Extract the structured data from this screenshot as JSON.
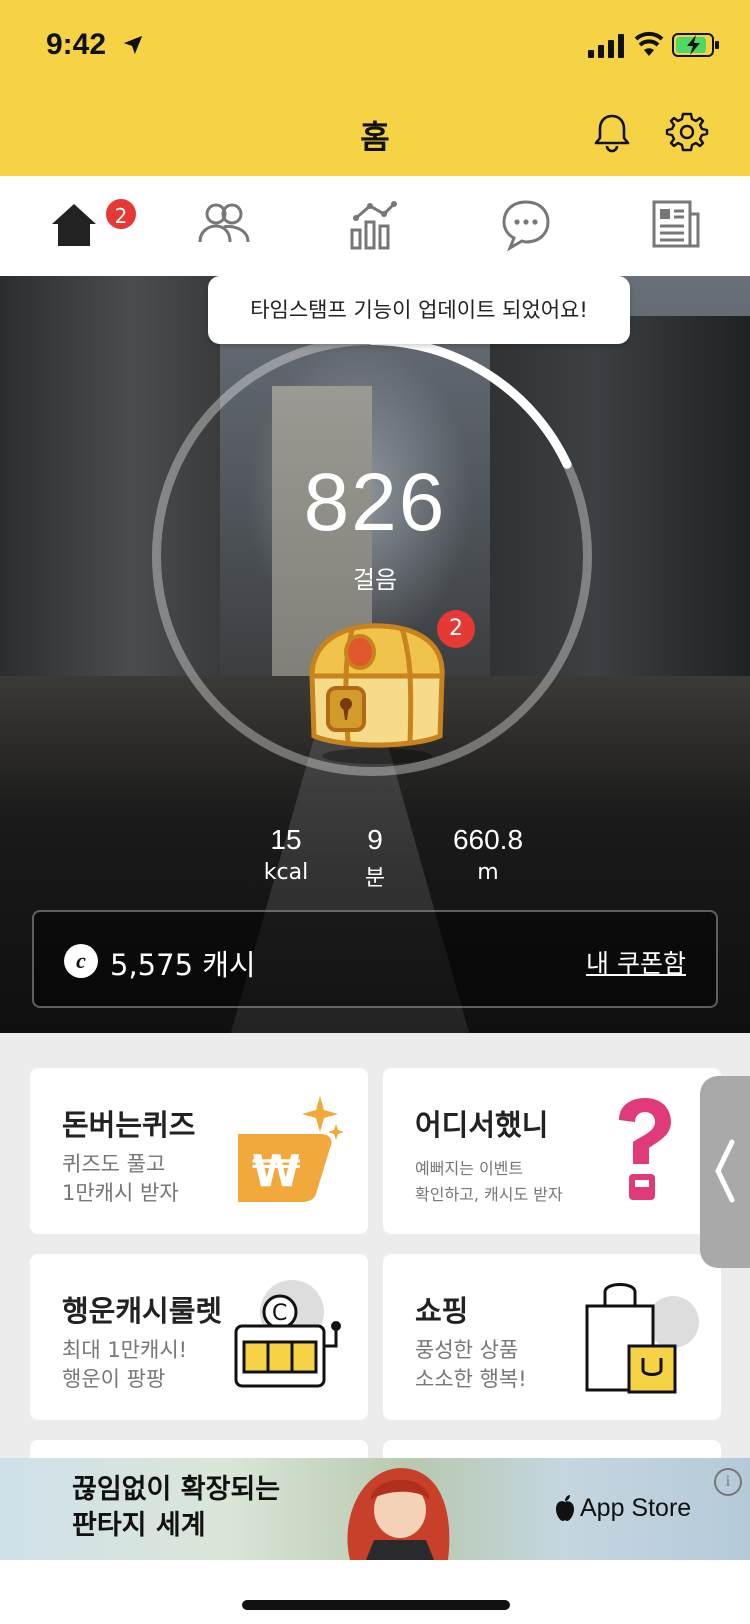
{
  "status": {
    "time": "9:42"
  },
  "header": {
    "title": "홈"
  },
  "tabs": {
    "home_badge": "2",
    "items": [
      {
        "icon": "home-icon"
      },
      {
        "icon": "friends-icon"
      },
      {
        "icon": "stats-icon"
      },
      {
        "icon": "chat-icon"
      },
      {
        "icon": "news-icon"
      }
    ]
  },
  "hero": {
    "tooltip": "타임스탬프 기능이 업데이트 되었어요!",
    "steps": "826",
    "steps_unit": "걸음",
    "chest_badge": "2",
    "progress": 0.18,
    "stats": [
      {
        "value": "15",
        "unit": "kcal"
      },
      {
        "value": "9",
        "unit": "분"
      },
      {
        "value": "660.8",
        "unit": "m"
      }
    ],
    "cash_symbol": "c",
    "cash": "5,575 캐시",
    "coupon_link": "내 쿠폰함"
  },
  "cards": [
    {
      "title": "돈버는퀴즈",
      "sub1": "퀴즈도 풀고",
      "sub2": "1만캐시 받자"
    },
    {
      "title": "어디서했니",
      "sub1": "예뻐지는 이벤트",
      "sub2": "확인하고, 캐시도 받자"
    },
    {
      "title": "행운캐시룰렛",
      "sub1": "최대 1만캐시!",
      "sub2": "행운이 팡팡"
    },
    {
      "title": "쇼핑",
      "sub1": "풍성한 상품",
      "sub2": "소소한 행복!"
    }
  ],
  "ad": {
    "line1": "끊임없이 확장되는",
    "line2": "판타지 세계",
    "store": "App Store",
    "info": "i"
  },
  "colors": {
    "brand_yellow": "#f6d245",
    "badge_red": "#e53935"
  }
}
